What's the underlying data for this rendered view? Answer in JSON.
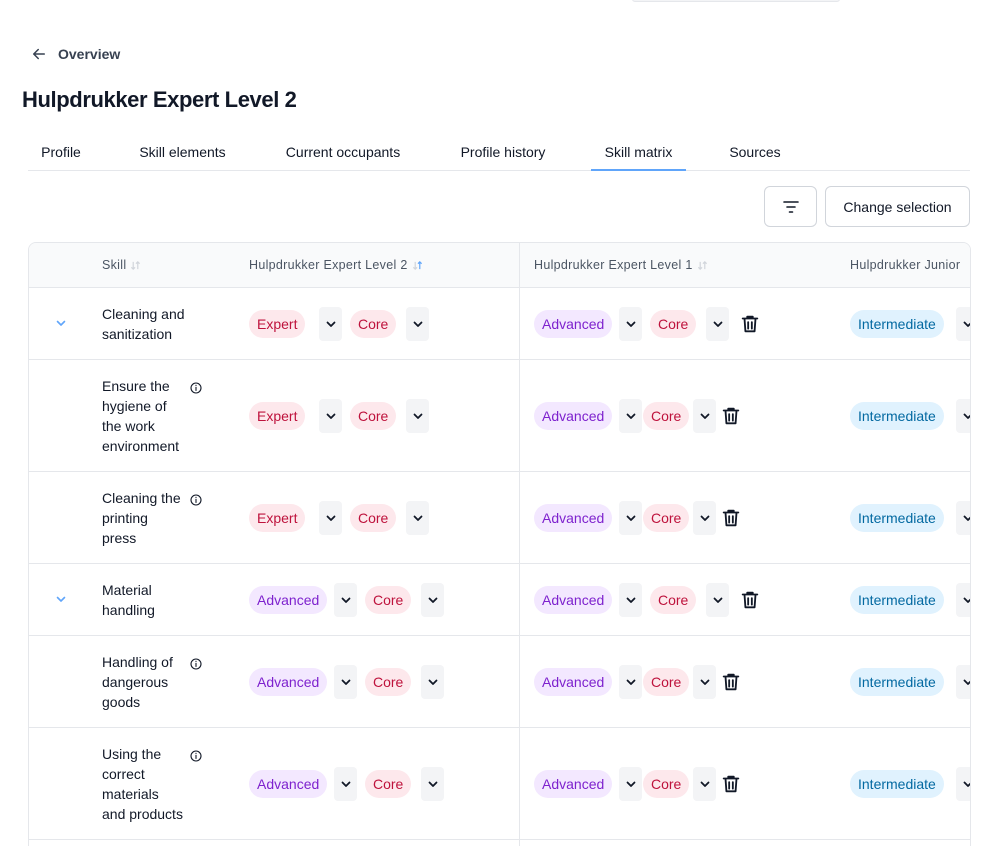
{
  "nav": {
    "back_label": "Overview"
  },
  "page": {
    "title": "Hulpdrukker Expert Level 2"
  },
  "tabs": [
    {
      "label": "Profile"
    },
    {
      "label": "Skill elements"
    },
    {
      "label": "Current occupants"
    },
    {
      "label": "Profile history"
    },
    {
      "label": "Skill matrix"
    },
    {
      "label": "Sources"
    }
  ],
  "active_tab": "Skill matrix",
  "toolbar": {
    "change_selection_label": "Change selection"
  },
  "grid": {
    "columns": [
      {
        "label": "Skill"
      },
      {
        "label": "Hulpdrukker Expert Level 2"
      },
      {
        "label": "Hulpdrukker Expert Level 1"
      },
      {
        "label": "Hulpdrukker Junior"
      }
    ],
    "rows": [
      {
        "skill": "Cleaning and sanitization",
        "lines": [
          "Cleaning and",
          "sanitization"
        ],
        "parent": true,
        "c1": {
          "level": "Expert",
          "type": "Core"
        },
        "c2": {
          "level": "Advanced",
          "type": "Core"
        },
        "c3": {
          "level": "Intermediate"
        }
      },
      {
        "skill": "Ensure the hygiene of the work environment",
        "lines": [
          "Ensure the",
          "hygiene of",
          "the work",
          "environment"
        ],
        "parent": false,
        "c1": {
          "level": "Expert",
          "type": "Core"
        },
        "c2": {
          "level": "Advanced",
          "type": "Core"
        },
        "c3": {
          "level": "Intermediate"
        }
      },
      {
        "skill": "Cleaning the printing press",
        "lines": [
          "Cleaning the",
          "printing",
          "press"
        ],
        "parent": false,
        "c1": {
          "level": "Expert",
          "type": "Core"
        },
        "c2": {
          "level": "Advanced",
          "type": "Core"
        },
        "c3": {
          "level": "Intermediate"
        }
      },
      {
        "skill": "Material handling",
        "lines": [
          "Material",
          "handling"
        ],
        "parent": true,
        "c1": {
          "level": "Advanced",
          "type": "Core"
        },
        "c2": {
          "level": "Advanced",
          "type": "Core"
        },
        "c3": {
          "level": "Intermediate"
        }
      },
      {
        "skill": "Handling of dangerous goods",
        "lines": [
          "Handling of",
          "dangerous",
          "goods"
        ],
        "parent": false,
        "c1": {
          "level": "Advanced",
          "type": "Core"
        },
        "c2": {
          "level": "Advanced",
          "type": "Core"
        },
        "c3": {
          "level": "Intermediate"
        }
      },
      {
        "skill": "Using the correct materials and products",
        "lines": [
          "Using the",
          "correct",
          "materials",
          "and products"
        ],
        "parent": false,
        "c1": {
          "level": "Advanced",
          "type": "Core"
        },
        "c2": {
          "level": "Advanced",
          "type": "Core"
        },
        "c3": {
          "level": "Intermediate"
        }
      }
    ]
  },
  "colors": {
    "tab_active_underline": "#60a5fa",
    "expert_bg": "#fde8ec",
    "expert_fg": "#be123c",
    "advanced_bg": "#f3e8ff",
    "advanced_fg": "#7e22ce",
    "intermediate_bg": "#e0f2fe",
    "intermediate_fg": "#0369a1"
  },
  "icons": [
    "arrow-left-icon",
    "sort-icon",
    "filter-icon",
    "chevron-down-icon",
    "info-icon",
    "trash-icon"
  ]
}
